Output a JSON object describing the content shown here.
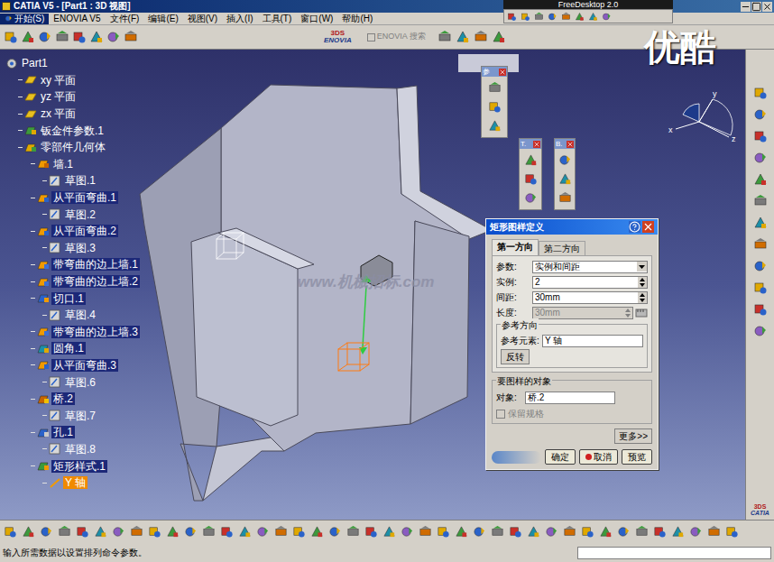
{
  "window": {
    "title": "CATIA V5 - [Part1 : 3D 视图]"
  },
  "overlay": {
    "title": "FreeDesktop 2.0"
  },
  "menu": [
    "开始(S)",
    "ENOVIA V5",
    "文件(F)",
    "编辑(E)",
    "视图(V)",
    "插入(I)",
    "工具(T)",
    "窗口(W)",
    "帮助(H)"
  ],
  "toolbar": {
    "logo": "ENOVIA",
    "search": {
      "label": "ENOVIA 搜索",
      "checked": false,
      "disabled": true
    }
  },
  "watermarks": {
    "brand": "优酷",
    "site": "www.机械招标.com"
  },
  "tree": [
    {
      "label": "Part1",
      "level": 0,
      "kind": "root",
      "highlighted": false,
      "selected": false
    },
    {
      "label": "xy 平面",
      "level": 1,
      "kind": "plane",
      "highlighted": false,
      "selected": false
    },
    {
      "label": "yz 平面",
      "level": 1,
      "kind": "plane",
      "highlighted": false,
      "selected": false
    },
    {
      "label": "zx 平面",
      "level": 1,
      "kind": "plane",
      "highlighted": false,
      "selected": false
    },
    {
      "label": "钣金件参数.1",
      "level": 1,
      "kind": "params",
      "highlighted": false,
      "selected": false
    },
    {
      "label": "零部件几何体",
      "level": 1,
      "kind": "body",
      "highlighted": false,
      "selected": false
    },
    {
      "label": "墙.1",
      "level": 2,
      "kind": "wall",
      "highlighted": false,
      "selected": false
    },
    {
      "label": "草图.1",
      "level": 3,
      "kind": "sketch",
      "highlighted": false,
      "selected": false
    },
    {
      "label": "从平面弯曲.1",
      "level": 2,
      "kind": "bend",
      "highlighted": true,
      "selected": false
    },
    {
      "label": "草图.2",
      "level": 3,
      "kind": "sketch",
      "highlighted": false,
      "selected": false
    },
    {
      "label": "从平面弯曲.2",
      "level": 2,
      "kind": "bend",
      "highlighted": true,
      "selected": false
    },
    {
      "label": "草图.3",
      "level": 3,
      "kind": "sketch",
      "highlighted": false,
      "selected": false
    },
    {
      "label": "带弯曲的边上墙.1",
      "level": 2,
      "kind": "flange",
      "highlighted": true,
      "selected": false
    },
    {
      "label": "带弯曲的边上墙.2",
      "level": 2,
      "kind": "flange",
      "highlighted": true,
      "selected": false
    },
    {
      "label": "切口.1",
      "level": 2,
      "kind": "cut",
      "highlighted": true,
      "selected": false
    },
    {
      "label": "草图.4",
      "level": 3,
      "kind": "sketch",
      "highlighted": false,
      "selected": false
    },
    {
      "label": "带弯曲的边上墙.3",
      "level": 2,
      "kind": "flange",
      "highlighted": true,
      "selected": false
    },
    {
      "label": "圆角.1",
      "level": 2,
      "kind": "round",
      "highlighted": true,
      "selected": false
    },
    {
      "label": "从平面弯曲.3",
      "level": 2,
      "kind": "bend",
      "highlighted": true,
      "selected": false
    },
    {
      "label": "草图.6",
      "level": 3,
      "kind": "sketch",
      "highlighted": false,
      "selected": false
    },
    {
      "label": "桥.2",
      "level": 2,
      "kind": "bridge",
      "highlighted": true,
      "selected": false
    },
    {
      "label": "草图.7",
      "level": 3,
      "kind": "sketch",
      "highlighted": false,
      "selected": false
    },
    {
      "label": "孔.1",
      "level": 2,
      "kind": "hole",
      "highlighted": true,
      "selected": false
    },
    {
      "label": "草图.8",
      "level": 3,
      "kind": "sketch",
      "highlighted": false,
      "selected": false
    },
    {
      "label": "矩形样式.1",
      "level": 2,
      "kind": "pattern",
      "highlighted": true,
      "selected": false
    },
    {
      "label": "Y 轴",
      "level": 3,
      "kind": "axis",
      "highlighted": false,
      "selected": true
    }
  ],
  "palettes": [
    {
      "title": "参"
    },
    {
      "title": "T."
    },
    {
      "title": "B."
    }
  ],
  "compass": {
    "axes": [
      "y",
      "x",
      "z"
    ]
  },
  "dialog": {
    "title": "矩形图样定义",
    "tabs": [
      {
        "label": "第一方向",
        "selected": true
      },
      {
        "label": "第二方向",
        "selected": false
      }
    ],
    "fields": [
      {
        "label": "参数:",
        "kind": "select",
        "value": "实例和间距",
        "disabled": false
      },
      {
        "label": "实例:",
        "kind": "spin",
        "value": "2",
        "disabled": false
      },
      {
        "label": "间距:",
        "kind": "spin",
        "value": "30mm",
        "disabled": false
      },
      {
        "label": "长度:",
        "kind": "spin",
        "value": "30mm",
        "disabled": true
      }
    ],
    "reference": {
      "legend": "参考方向",
      "label": "参考元素:",
      "value": "Y 轴",
      "button": "反转"
    },
    "object": {
      "legend": "要图样的对象",
      "label": "对象:",
      "value": "桥.2",
      "checkbox": {
        "label": "保留规格",
        "checked": false,
        "disabled": true
      }
    },
    "more": "更多>>",
    "buttons": [
      {
        "label": "确定",
        "kind": "ok"
      },
      {
        "label": "取消",
        "kind": "cancel"
      },
      {
        "label": "预览",
        "kind": "preview"
      }
    ]
  },
  "logo": "CATIA",
  "status_bar": "输入所需数据以设置排列命令参数。"
}
